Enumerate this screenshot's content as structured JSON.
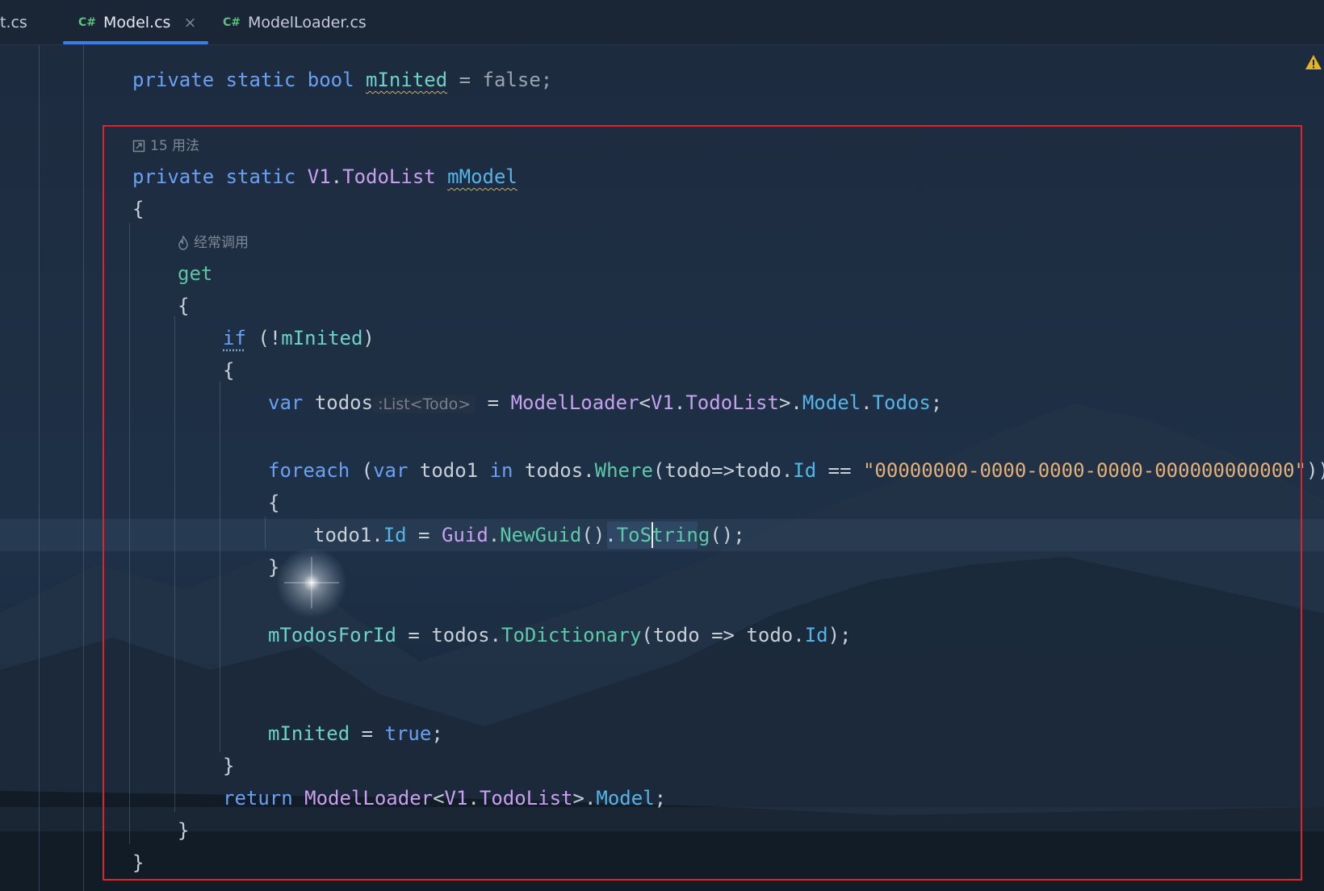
{
  "tabs": [
    {
      "lang": "",
      "name": "t.cs",
      "active": false
    },
    {
      "lang": "C#",
      "name": "Model.cs",
      "active": true,
      "close": "×"
    },
    {
      "lang": "C#",
      "name": "ModelLoader.cs",
      "active": false
    }
  ],
  "lens": {
    "usages": "15 用法",
    "frequent": "经常调用"
  },
  "code": {
    "l1": {
      "private": "private",
      "static": "static",
      "bool": "bool",
      "name": "mInited",
      "eq": " = ",
      "val": "false",
      "end": ";"
    },
    "l2": {
      "private": "private",
      "static": "static",
      "ns": "V1",
      "dot": ".",
      "type": "TodoList",
      "name": "mModel"
    },
    "brace_open": "{",
    "brace_close": "}",
    "get": "get",
    "if": {
      "kw": "if",
      "rest_open": " (!",
      "field": "mInited",
      "rest_close": ")"
    },
    "var_line": {
      "var": "var",
      "name": "todos",
      "hint": ":List<Todo>",
      "eq": " = ",
      "loader": "ModelLoader",
      "lt": "<",
      "ns": "V1",
      "dot": ".",
      "type": "TodoList",
      "gt": ">.",
      "model": "Model",
      "dot2": ".",
      "todos": "Todos",
      "end": ";"
    },
    "foreach_line": {
      "foreach": "foreach",
      "open": " (",
      "var": "var",
      "item": " todo1 ",
      "in": "in",
      "src": " todos.",
      "where": "Where",
      "lambda": "(todo=>todo.",
      "id": "Id",
      "cmp": " == ",
      "str": "\"00000000-0000-0000-0000-000000000000\"",
      "close": "))"
    },
    "assign_line": {
      "target": "todo1.",
      "id": "Id",
      "eq": " = ",
      "guid": "Guid",
      "dot": ".",
      "newguid": "NewGuid",
      "paren": "().",
      "tostring": "ToString",
      "end": "();"
    },
    "dict_line": {
      "field": "mTodosForId",
      "eq": " = ",
      "src": "todos.",
      "method": "ToDictionary",
      "lambda": "(todo => todo.",
      "id": "Id",
      "end": ");"
    },
    "inited_line": {
      "field": "mInited",
      "eq": " = ",
      "val": "true",
      "end": ";"
    },
    "return_line": {
      "kw": "return",
      "loader": " ModelLoader",
      "lt": "<",
      "ns": "V1",
      "dot": ".",
      "type": "TodoList",
      "gt": ">.",
      "model": "Model",
      "end": ";"
    }
  },
  "colors": {
    "frame": "#e0222c",
    "keyword": "#6aa0f2",
    "type": "#c7a0ee",
    "string": "#e4b07a",
    "method": "#5cc9a8"
  }
}
